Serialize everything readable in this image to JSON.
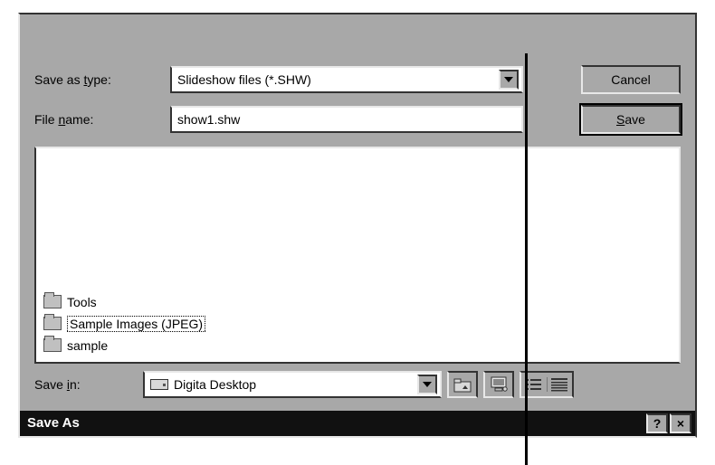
{
  "title": "Save As",
  "titlebar": {
    "help": "?",
    "close": "×"
  },
  "savein": {
    "label_pre": "Save ",
    "label_u": "i",
    "label_post": "n:",
    "value": "Digita Desktop"
  },
  "toolbar_icons": {
    "up": "up-one-level-icon",
    "desktop": "desktop-icon",
    "list": "list-view-icon",
    "details": "details-view-icon"
  },
  "files": [
    {
      "name": "sample",
      "selected": false
    },
    {
      "name": "Sample Images (JPEG)",
      "selected": true
    },
    {
      "name": "Tools",
      "selected": false
    }
  ],
  "filename": {
    "label_pre": "File ",
    "label_u": "n",
    "label_post": "ame:",
    "value": "show1.shw"
  },
  "saveastype": {
    "label_pre": "Save as ",
    "label_u": "t",
    "label_post": "ype:",
    "value": "Slideshow files (*.SHW)"
  },
  "buttons": {
    "save_u": "S",
    "save_rest": "ave",
    "cancel": "Cancel"
  }
}
